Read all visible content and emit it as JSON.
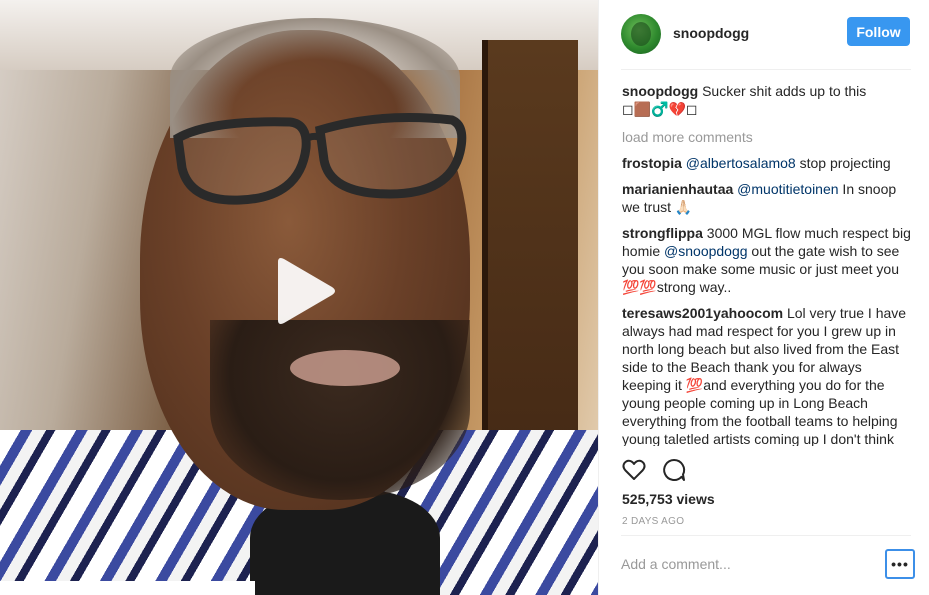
{
  "post": {
    "author": "snoopdogg",
    "follow_label": "Follow",
    "caption_user": "snoopdogg",
    "caption_text": "Sucker shit adds up to this",
    "caption_emoji": "◻🟫♂️💔◻",
    "load_more": "load more comments",
    "comments": [
      {
        "user": "frostopia",
        "parts": [
          {
            "mention": "@albertosalamo8"
          },
          {
            "text": " stop projecting"
          }
        ]
      },
      {
        "user": "marianienhautaa",
        "parts": [
          {
            "mention": "@muotitietoinen"
          },
          {
            "text": " In snoop we trust 🙏🏻"
          }
        ]
      },
      {
        "user": "strongflippa",
        "parts": [
          {
            "text": "3000 MGL flow much respect big homie "
          },
          {
            "mention": "@snoopdogg"
          },
          {
            "text": " out the gate wish to see you soon make some music or just meet you 💯💯strong way.."
          }
        ]
      },
      {
        "user": "teresaws2001yahoocom",
        "parts": [
          {
            "text": "Lol very true I have always had mad respect for you I grew up in north long beach but also lived from the East side to the Beach thank you for always keeping it 💯and everything you do for the young people coming up in Long Beach everything from the football teams to helping young taletled artists coming up I don't think people realize how much you"
          }
        ]
      }
    ],
    "views": "525,753 views",
    "date": "2 DAYS AGO",
    "add_comment_placeholder": "Add a comment...",
    "more_label": "•••",
    "icons": {
      "like": "heart-icon",
      "comment": "speech-bubble-icon",
      "play": "play-icon"
    }
  },
  "colors": {
    "follow_bg": "#3897f0",
    "mention": "#003569",
    "muted": "#999999",
    "focus_ring": "#3c8fe8"
  }
}
